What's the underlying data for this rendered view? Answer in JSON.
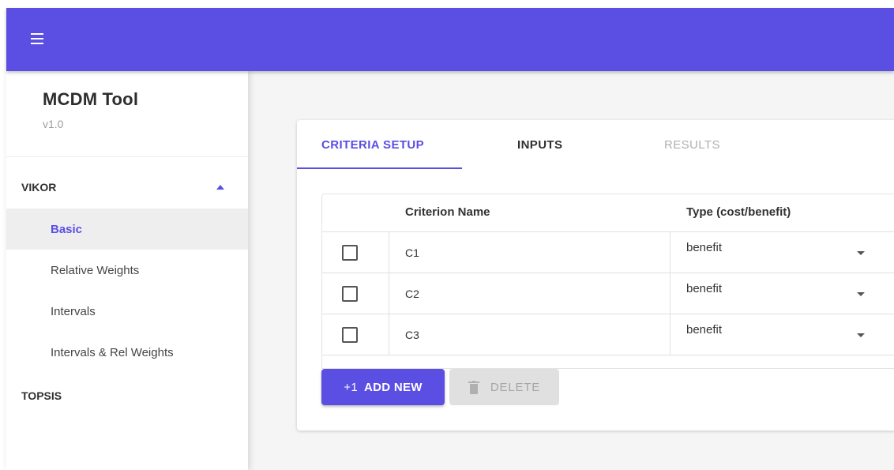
{
  "appbar": {
    "menu_icon": "hamburger-menu-icon",
    "color": "#5b4ee3"
  },
  "sidebar": {
    "title": "MCDM Tool",
    "version": "v1.0",
    "group": {
      "label": "VIKOR",
      "expanded": true,
      "icon": "caret-up-icon"
    },
    "items": [
      {
        "label": "Basic",
        "active": true
      },
      {
        "label": "Relative Weights",
        "active": false
      },
      {
        "label": "Intervals",
        "active": false
      },
      {
        "label": "Intervals & Rel Weights",
        "active": false
      }
    ],
    "other_group": {
      "label": "TOPSIS"
    }
  },
  "tabs": [
    {
      "label": "CRITERIA SETUP",
      "state": "active"
    },
    {
      "label": "INPUTS",
      "state": "enabled"
    },
    {
      "label": "RESULTS",
      "state": "disabled"
    }
  ],
  "table": {
    "headers": {
      "name": "Criterion Name",
      "type": "Type (cost/benefit)"
    },
    "rows": [
      {
        "name": "C1",
        "type": "benefit",
        "checked": false
      },
      {
        "name": "C2",
        "type": "benefit",
        "checked": false
      },
      {
        "name": "C3",
        "type": "benefit",
        "checked": false
      }
    ]
  },
  "actions": {
    "add": {
      "icon_text": "+1",
      "label": "ADD NEW"
    },
    "delete": {
      "label": "DELETE",
      "icon": "trash-icon",
      "disabled": true
    }
  },
  "colors": {
    "accent": "#5b4ee3",
    "disabled_text": "#b0b0b0",
    "active_nav_bg": "#eeeeee"
  }
}
